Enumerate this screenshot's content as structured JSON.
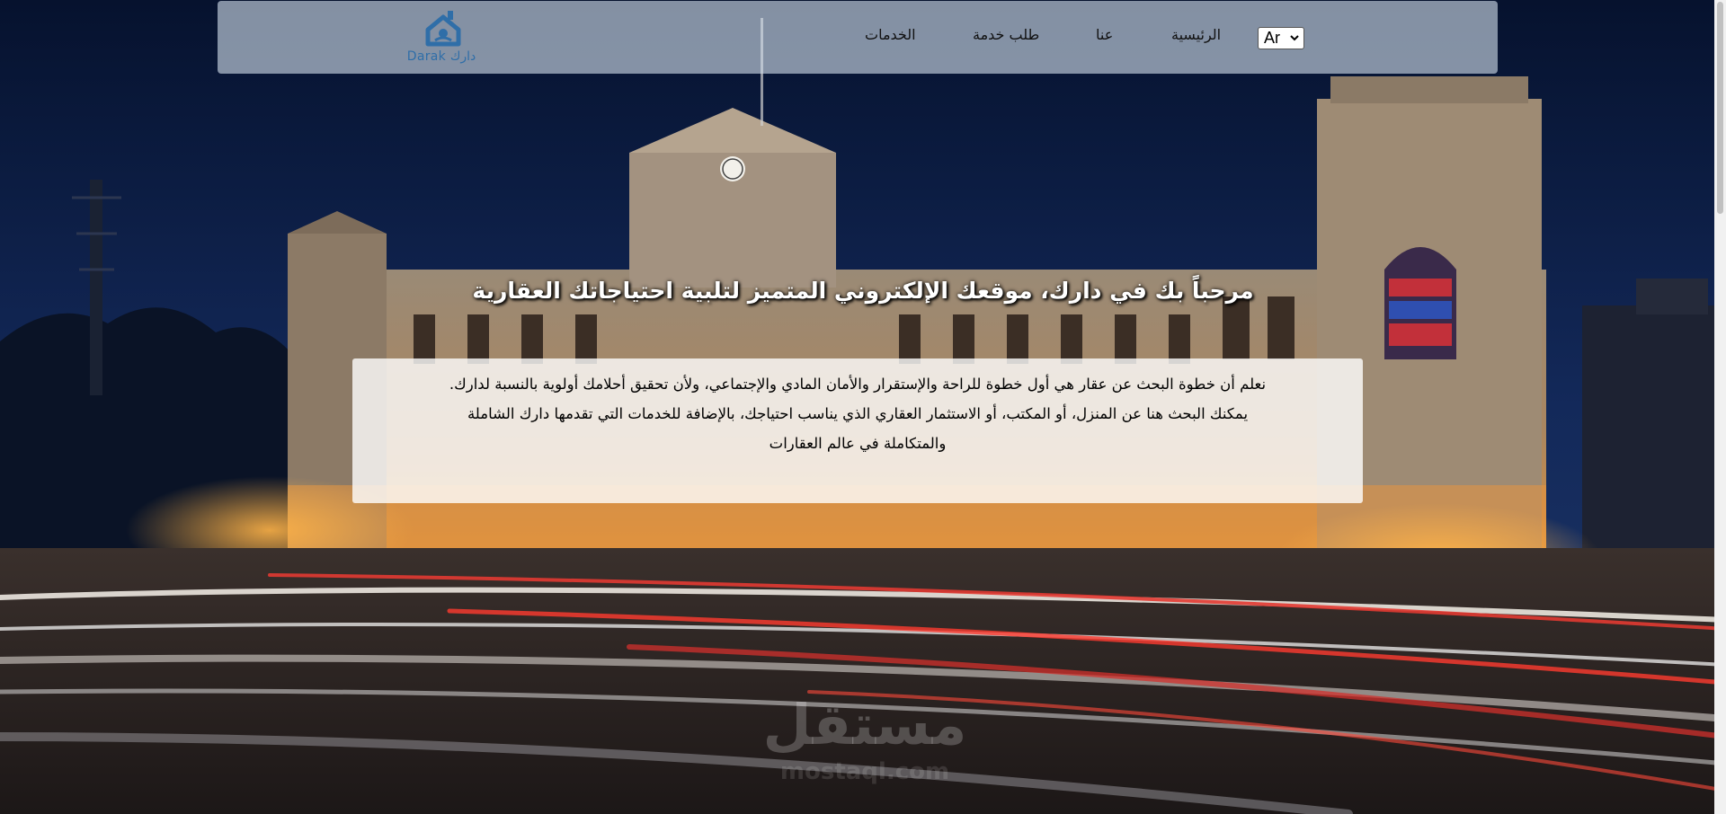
{
  "navbar": {
    "brand": {
      "name_en": "Darak",
      "name_ar": "دارك",
      "logo_icon": "house-key-logo-icon",
      "color": "#2f6ea8"
    },
    "links": {
      "services": "الخدمات",
      "request_service": "طلب خدمة",
      "about": "عنا",
      "home": "الرئيسية"
    },
    "language": {
      "selected": "Ar"
    }
  },
  "hero": {
    "title": "مرحباً بك في دارك، موقعك الإلكتروني المتميز لتلبية احتياجاتك العقارية",
    "intro_lines": [
      "نعلم أن خطوة البحث عن عقار هي أول خطوة للراحة والإستقرار والأمان المادي والإجتماعي، ولأن تحقيق أحلامك أولوية بالنسبة لدارك.",
      "يمكنك البحث هنا عن المنزل، أو المكتب، أو الاستثمار العقاري الذي يناسب احتياجك، بالإضافة للخدمات التي تقدمها دارك الشاملة",
      "والمتكاملة في عالم العقارات"
    ]
  },
  "watermark": {
    "text": "مستقل",
    "sub": "mostaql.com"
  },
  "colors": {
    "navbar_bg": "#d2deec",
    "sky": "#0b1a3a",
    "building": "#c9a77a"
  }
}
